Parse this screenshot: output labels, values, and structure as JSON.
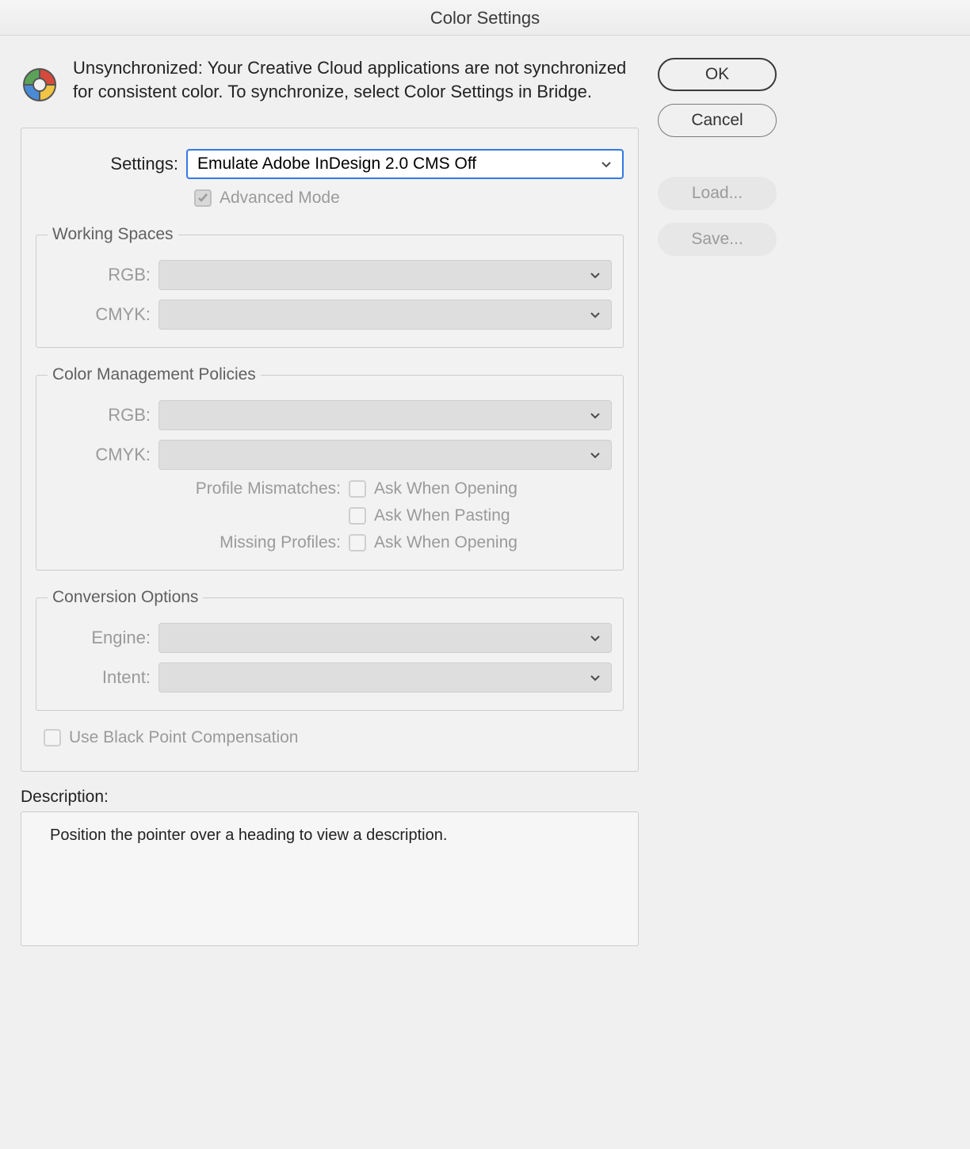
{
  "window_title": "Color Settings",
  "sync_message": "Unsynchronized: Your Creative Cloud applications are not synchronized for consistent color. To synchronize, select Color Settings in Bridge.",
  "settings": {
    "label": "Settings:",
    "value": "Emulate Adobe InDesign 2.0 CMS Off",
    "advanced_mode_label": "Advanced Mode",
    "advanced_mode_checked": true
  },
  "working_spaces": {
    "legend": "Working Spaces",
    "rgb_label": "RGB:",
    "rgb_value": "",
    "cmyk_label": "CMYK:",
    "cmyk_value": ""
  },
  "policies": {
    "legend": "Color Management Policies",
    "rgb_label": "RGB:",
    "rgb_value": "",
    "cmyk_label": "CMYK:",
    "cmyk_value": "",
    "profile_mismatches_label": "Profile Mismatches:",
    "ask_when_opening_label": "Ask When Opening",
    "ask_when_pasting_label": "Ask When Pasting",
    "missing_profiles_label": "Missing Profiles:"
  },
  "conversion": {
    "legend": "Conversion Options",
    "engine_label": "Engine:",
    "engine_value": "",
    "intent_label": "Intent:",
    "intent_value": "",
    "black_point_label": "Use Black Point Compensation"
  },
  "description": {
    "label": "Description:",
    "text": "Position the pointer over a heading to view a description."
  },
  "buttons": {
    "ok": "OK",
    "cancel": "Cancel",
    "load": "Load...",
    "save": "Save..."
  }
}
